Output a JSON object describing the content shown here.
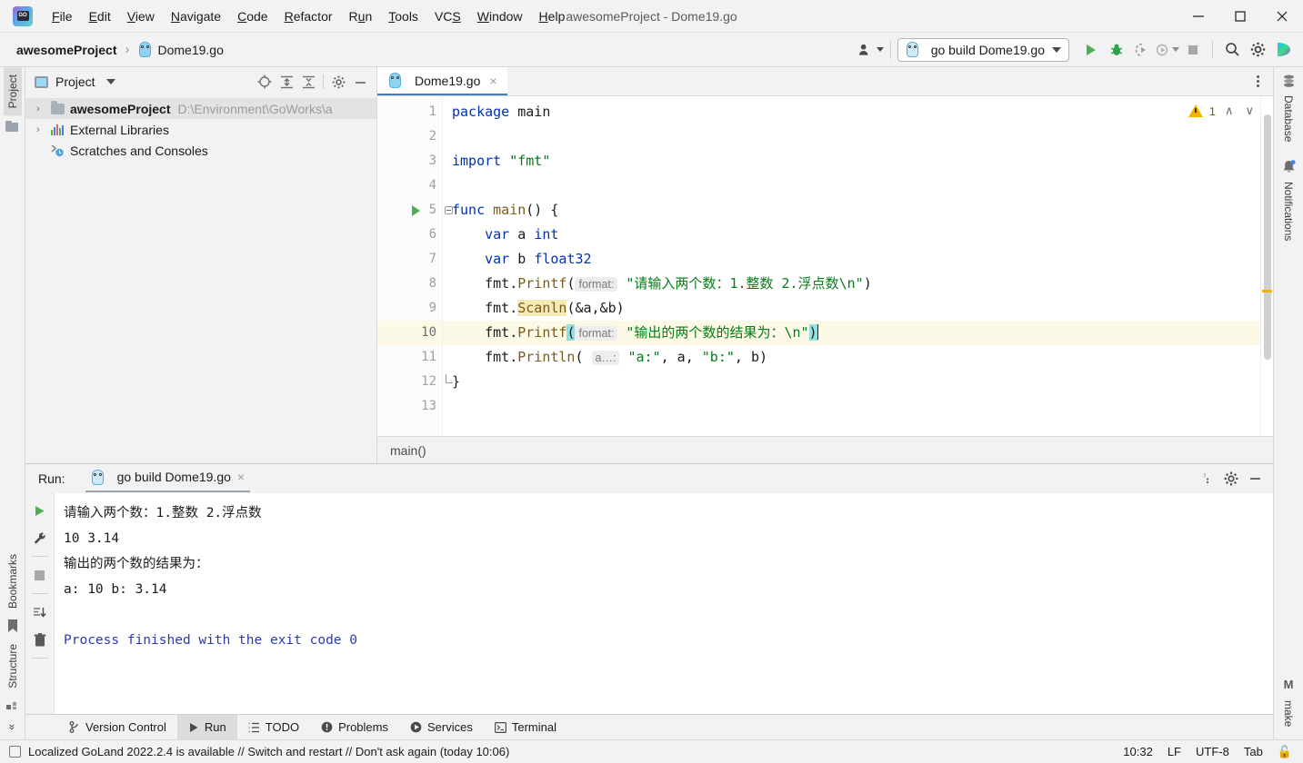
{
  "window": {
    "title": "awesomeProject - Dome19.go",
    "controls": {
      "minimize": "minimize-icon",
      "maximize": "maximize-icon",
      "close": "close-icon"
    }
  },
  "menu": {
    "items": [
      {
        "label": "File",
        "mnemonic": "F"
      },
      {
        "label": "Edit",
        "mnemonic": "E"
      },
      {
        "label": "View",
        "mnemonic": "V"
      },
      {
        "label": "Navigate",
        "mnemonic": "N"
      },
      {
        "label": "Code",
        "mnemonic": "C"
      },
      {
        "label": "Refactor",
        "mnemonic": "R"
      },
      {
        "label": "Run",
        "mnemonic": "u"
      },
      {
        "label": "Tools",
        "mnemonic": "T"
      },
      {
        "label": "VCS",
        "mnemonic": "S"
      },
      {
        "label": "Window",
        "mnemonic": "W"
      },
      {
        "label": "Help",
        "mnemonic": "H"
      }
    ]
  },
  "toolbar": {
    "breadcrumb": {
      "project": "awesomeProject",
      "separator": "›",
      "file": "Dome19.go"
    },
    "run_config": {
      "label": "go build Dome19.go",
      "icon": "go-file-icon"
    },
    "buttons": [
      {
        "name": "run-button",
        "icon": "play-icon",
        "color": "#4caf50"
      },
      {
        "name": "debug-button",
        "icon": "bug-icon",
        "color": "#2ea24a"
      },
      {
        "name": "run-with-coverage-button",
        "icon": "coverage-icon",
        "color": "#9a9a9a"
      },
      {
        "name": "profile-button",
        "icon": "profile-icon",
        "color": "#9a9a9a"
      },
      {
        "name": "stop-button",
        "icon": "stop-icon",
        "color": "#a8a8a8"
      },
      {
        "name": "search-everywhere-button",
        "icon": "search-icon",
        "color": "#4a4a4a"
      },
      {
        "name": "settings-button",
        "icon": "gear-icon",
        "color": "#4a4a4a"
      }
    ],
    "user_icon": "user-avatar-icon",
    "ai_icon": "ai-assistant-icon"
  },
  "left_strip": {
    "top": [
      {
        "label": "Project",
        "icon": "project-icon",
        "active": true
      }
    ],
    "bottom": [
      {
        "label": "Bookmarks",
        "icon": "bookmark-icon"
      },
      {
        "label": "Structure",
        "icon": "structure-icon"
      }
    ],
    "expand": "»"
  },
  "right_strip": {
    "top": [
      {
        "label": "Database",
        "icon": "database-icon"
      },
      {
        "label": "Notifications",
        "icon": "bell-icon"
      }
    ],
    "bottom": [
      {
        "label": "make",
        "icon": "make-m-icon",
        "prefix": "M"
      }
    ]
  },
  "project_panel": {
    "title": "Project",
    "icons": [
      "locate-icon",
      "expand-all-icon",
      "collapse-all-icon",
      "gear-icon",
      "hide-icon"
    ],
    "tree": [
      {
        "label": "awesomeProject",
        "path": "D:\\Environment\\GoWorks\\a",
        "icon": "folder-icon",
        "arrow": "›",
        "bold": true,
        "selected": true
      },
      {
        "label": "External Libraries",
        "path": "",
        "icon": "library-icon",
        "arrow": "›",
        "bold": false,
        "selected": false
      },
      {
        "label": "Scratches and Consoles",
        "path": "",
        "icon": "scratches-icon",
        "arrow": "",
        "bold": false,
        "selected": false
      }
    ]
  },
  "editor": {
    "tab": {
      "label": "Dome19.go",
      "icon": "go-file-icon",
      "close": "×"
    },
    "breadcrumb": "main()",
    "warnings": {
      "count": "1",
      "icon": "warning-triangle-icon",
      "up": "∧",
      "down": "∨"
    },
    "lines": [
      {
        "n": "1",
        "tokens": [
          {
            "t": "kw",
            "v": "package"
          },
          {
            "t": "sp",
            "v": " "
          },
          {
            "t": "ident",
            "v": "main"
          }
        ]
      },
      {
        "n": "2",
        "tokens": []
      },
      {
        "n": "3",
        "tokens": [
          {
            "t": "kw",
            "v": "import"
          },
          {
            "t": "sp",
            "v": " "
          },
          {
            "t": "str",
            "v": "\"fmt\""
          }
        ]
      },
      {
        "n": "4",
        "tokens": []
      },
      {
        "n": "5",
        "tokens": [
          {
            "t": "kw",
            "v": "func"
          },
          {
            "t": "sp",
            "v": " "
          },
          {
            "t": "fn",
            "v": "main"
          },
          {
            "t": "ident",
            "v": "() {"
          }
        ],
        "runnable": true,
        "fold": "start"
      },
      {
        "n": "6",
        "tokens": [
          {
            "t": "sp",
            "v": "    "
          },
          {
            "t": "kw",
            "v": "var"
          },
          {
            "t": "sp",
            "v": " "
          },
          {
            "t": "ident",
            "v": "a"
          },
          {
            "t": "sp",
            "v": " "
          },
          {
            "t": "typ",
            "v": "int"
          }
        ]
      },
      {
        "n": "7",
        "tokens": [
          {
            "t": "sp",
            "v": "    "
          },
          {
            "t": "kw",
            "v": "var"
          },
          {
            "t": "sp",
            "v": " "
          },
          {
            "t": "ident",
            "v": "b"
          },
          {
            "t": "sp",
            "v": " "
          },
          {
            "t": "typ",
            "v": "float32"
          }
        ]
      },
      {
        "n": "8",
        "tokens": [
          {
            "t": "sp",
            "v": "    "
          },
          {
            "t": "ident",
            "v": "fmt."
          },
          {
            "t": "fn",
            "v": "Printf"
          },
          {
            "t": "ident",
            "v": "("
          },
          {
            "t": "hint",
            "v": "format:"
          },
          {
            "t": "sp",
            "v": " "
          },
          {
            "t": "str",
            "v": "\"请输入两个数：1.整数 2.浮点数\\n\""
          },
          {
            "t": "ident",
            "v": ")"
          }
        ]
      },
      {
        "n": "9",
        "tokens": [
          {
            "t": "sp",
            "v": "    "
          },
          {
            "t": "ident",
            "v": "fmt."
          },
          {
            "t": "fnhl",
            "v": "Scanln"
          },
          {
            "t": "ident",
            "v": "(&a,&b)"
          }
        ]
      },
      {
        "n": "10",
        "tokens": [
          {
            "t": "sp",
            "v": "    "
          },
          {
            "t": "ident",
            "v": "fmt."
          },
          {
            "t": "fn",
            "v": "Printf"
          },
          {
            "t": "paren",
            "v": "("
          },
          {
            "t": "hint",
            "v": "format:"
          },
          {
            "t": "sp",
            "v": " "
          },
          {
            "t": "str",
            "v": "\"输出的两个数的结果为：\\n\""
          },
          {
            "t": "paren",
            "v": ")"
          },
          {
            "t": "caret",
            "v": ""
          }
        ],
        "current": true
      },
      {
        "n": "11",
        "tokens": [
          {
            "t": "sp",
            "v": "    "
          },
          {
            "t": "ident",
            "v": "fmt."
          },
          {
            "t": "fn",
            "v": "Println"
          },
          {
            "t": "ident",
            "v": "( "
          },
          {
            "t": "hint",
            "v": "a…:"
          },
          {
            "t": "sp",
            "v": " "
          },
          {
            "t": "str",
            "v": "\"a:\""
          },
          {
            "t": "ident",
            "v": ", a, "
          },
          {
            "t": "str",
            "v": "\"b:\""
          },
          {
            "t": "ident",
            "v": ", b)"
          }
        ]
      },
      {
        "n": "12",
        "tokens": [
          {
            "t": "ident",
            "v": "}"
          }
        ],
        "fold": "end"
      },
      {
        "n": "13",
        "tokens": []
      }
    ]
  },
  "run_panel": {
    "label": "Run:",
    "tab": {
      "label": "go build Dome19.go",
      "icon": "go-run-icon",
      "close": "×"
    },
    "header_icons": [
      "more-icon",
      "gear-icon",
      "hide-icon"
    ],
    "tools": [
      {
        "name": "rerun-button",
        "icon": "play-icon"
      },
      {
        "name": "edit-configuration-button",
        "icon": "wrench-icon"
      },
      {
        "name": "stop-button",
        "icon": "stop-icon"
      },
      {
        "name": "scroll-to-end-button",
        "icon": "scroll-end-icon"
      },
      {
        "name": "clear-all-button",
        "icon": "trash-icon"
      }
    ],
    "console": [
      {
        "text": "请输入两个数：1.整数 2.浮点数",
        "style": "plain"
      },
      {
        "text": "10 3.14",
        "style": "plain"
      },
      {
        "text": "输出的两个数的结果为：",
        "style": "plain"
      },
      {
        "text": "a: 10 b: 3.14",
        "style": "plain"
      },
      {
        "text": "",
        "style": "plain"
      },
      {
        "text": "Process finished with the exit code 0",
        "style": "blue"
      }
    ]
  },
  "tool_tabs": [
    {
      "label": "Version Control",
      "icon": "branch-icon",
      "active": false
    },
    {
      "label": "Run",
      "icon": "play-icon",
      "active": true
    },
    {
      "label": "TODO",
      "icon": "list-icon",
      "active": false
    },
    {
      "label": "Problems",
      "icon": "problems-icon",
      "active": false
    },
    {
      "label": "Services",
      "icon": "services-icon",
      "active": false
    },
    {
      "label": "Terminal",
      "icon": "terminal-icon",
      "active": false
    }
  ],
  "status_bar": {
    "icon": "notification-box-icon",
    "message": "Localized GoLand 2022.2.4 is available // Switch and restart // Don't ask again (today 10:06)",
    "right": [
      {
        "name": "caret-position",
        "value": "10:32"
      },
      {
        "name": "line-separator",
        "value": "LF"
      },
      {
        "name": "file-encoding",
        "value": "UTF-8"
      },
      {
        "name": "indent-setting",
        "value": "Tab"
      },
      {
        "name": "readonly-toggle",
        "value": "🔓"
      }
    ]
  }
}
